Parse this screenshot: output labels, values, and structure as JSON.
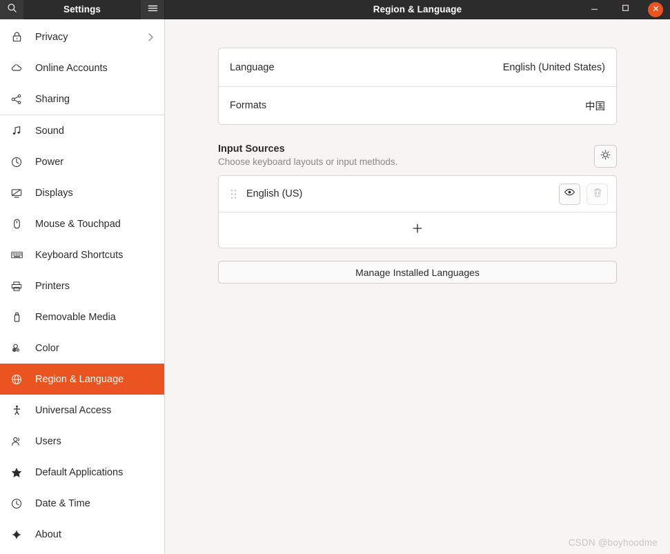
{
  "titlebar": {
    "app_title": "Settings",
    "page_title": "Region & Language",
    "search_icon": "search-icon",
    "menu_icon": "hamburger-menu-icon",
    "minimize_icon": "minimize-icon",
    "maximize_icon": "maximize-icon",
    "close_icon": "close-icon",
    "close_color": "#e95420",
    "bar_color": "#2c2c2c"
  },
  "sidebar": {
    "accent_color": "#e95420",
    "items": [
      {
        "label": "Privacy",
        "icon": "lock-icon",
        "chevron": true,
        "active": false
      },
      {
        "label": "Online Accounts",
        "icon": "cloud-icon",
        "chevron": false,
        "active": false
      },
      {
        "label": "Sharing",
        "icon": "share-nodes-icon",
        "chevron": false,
        "active": false
      },
      {
        "label": "Sound",
        "icon": "music-note-icon",
        "chevron": false,
        "active": false,
        "separator_before": true
      },
      {
        "label": "Power",
        "icon": "power-icon",
        "chevron": false,
        "active": false
      },
      {
        "label": "Displays",
        "icon": "display-icon",
        "chevron": false,
        "active": false
      },
      {
        "label": "Mouse & Touchpad",
        "icon": "mouse-icon",
        "chevron": false,
        "active": false
      },
      {
        "label": "Keyboard Shortcuts",
        "icon": "keyboard-icon",
        "chevron": false,
        "active": false
      },
      {
        "label": "Printers",
        "icon": "printer-icon",
        "chevron": false,
        "active": false
      },
      {
        "label": "Removable Media",
        "icon": "usb-drive-icon",
        "chevron": false,
        "active": false
      },
      {
        "label": "Color",
        "icon": "color-icon",
        "chevron": false,
        "active": false
      },
      {
        "label": "Region & Language",
        "icon": "globe-icon",
        "chevron": false,
        "active": true
      },
      {
        "label": "Universal Access",
        "icon": "accessibility-icon",
        "chevron": false,
        "active": false
      },
      {
        "label": "Users",
        "icon": "users-icon",
        "chevron": false,
        "active": false
      },
      {
        "label": "Default Applications",
        "icon": "star-icon",
        "chevron": false,
        "active": false
      },
      {
        "label": "Date & Time",
        "icon": "clock-icon",
        "chevron": false,
        "active": false
      },
      {
        "label": "About",
        "icon": "sparkle-icon",
        "chevron": false,
        "active": false
      }
    ]
  },
  "main": {
    "language_card": {
      "rows": [
        {
          "label": "Language",
          "value": "English (United States)"
        },
        {
          "label": "Formats",
          "value": "中国"
        }
      ]
    },
    "input_sources": {
      "title": "Input Sources",
      "subtitle": "Choose keyboard layouts or input methods.",
      "options_icon": "gear-icon",
      "sources": [
        {
          "name": "English (US)",
          "drag_icon": "drag-handle-icon",
          "preview_icon": "eye-icon",
          "preview_enabled": true,
          "remove_icon": "trash-icon",
          "remove_enabled": false
        }
      ],
      "add_icon": "plus-icon"
    },
    "manage_button": "Manage Installed Languages"
  },
  "watermark": "CSDN @boyhoodme"
}
